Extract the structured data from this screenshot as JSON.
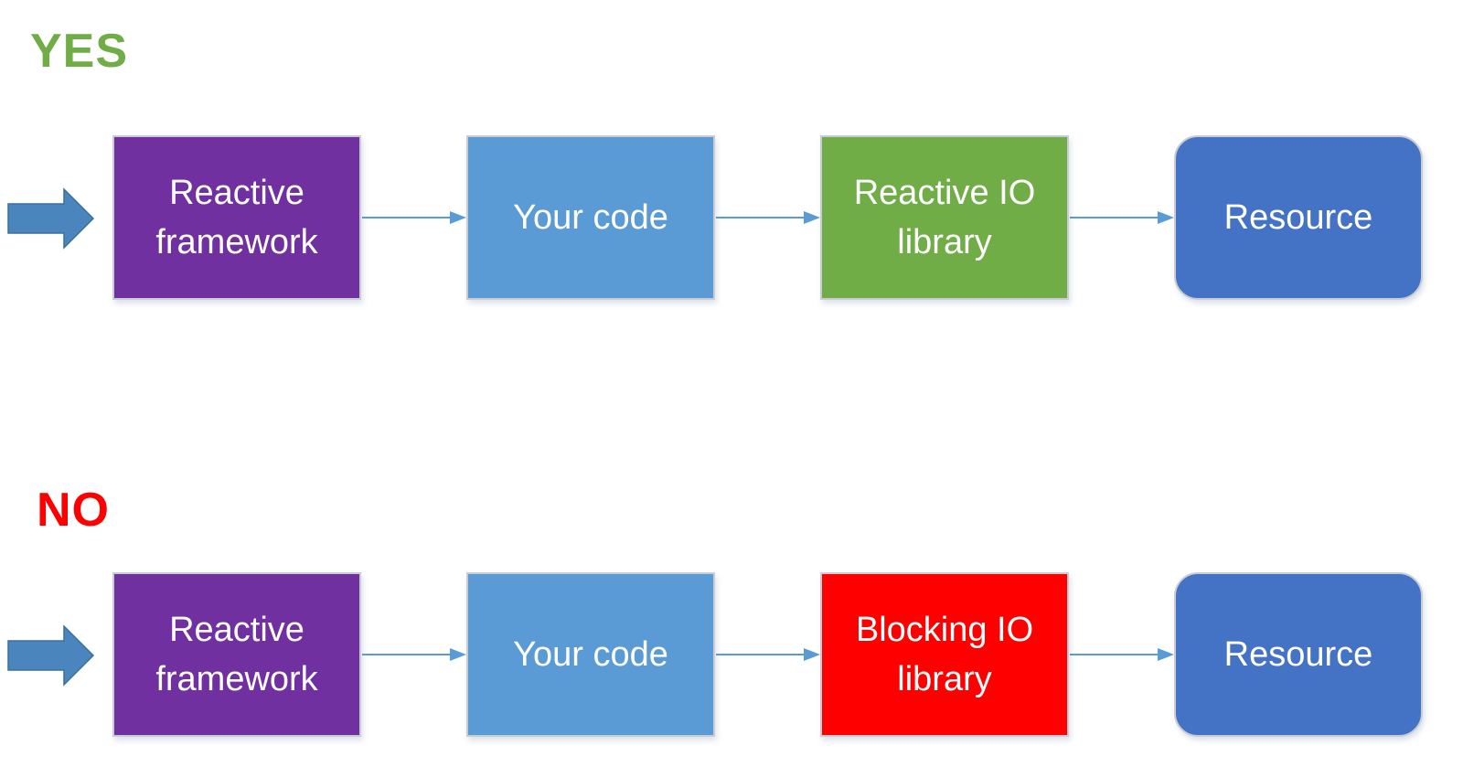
{
  "rows": [
    {
      "label": "YES",
      "label_color": "#70ad47",
      "boxes": [
        {
          "text": "Reactive\nframework",
          "color": "#7030a0"
        },
        {
          "text": "Your code",
          "color": "#5b9bd5"
        },
        {
          "text": "Reactive IO\nlibrary",
          "color": "#70ad47"
        },
        {
          "text": "Resource",
          "color": "#4472c4"
        }
      ]
    },
    {
      "label": "NO",
      "label_color": "#ff0000",
      "boxes": [
        {
          "text": "Reactive\nframework",
          "color": "#7030a0"
        },
        {
          "text": "Your code",
          "color": "#5b9bd5"
        },
        {
          "text": "Blocking IO\nlibrary",
          "color": "#ff0000"
        },
        {
          "text": "Resource",
          "color": "#4472c4"
        }
      ]
    }
  ],
  "colors": {
    "entry_arrow": "#4a86bd",
    "connector": "#5b9bd5"
  }
}
